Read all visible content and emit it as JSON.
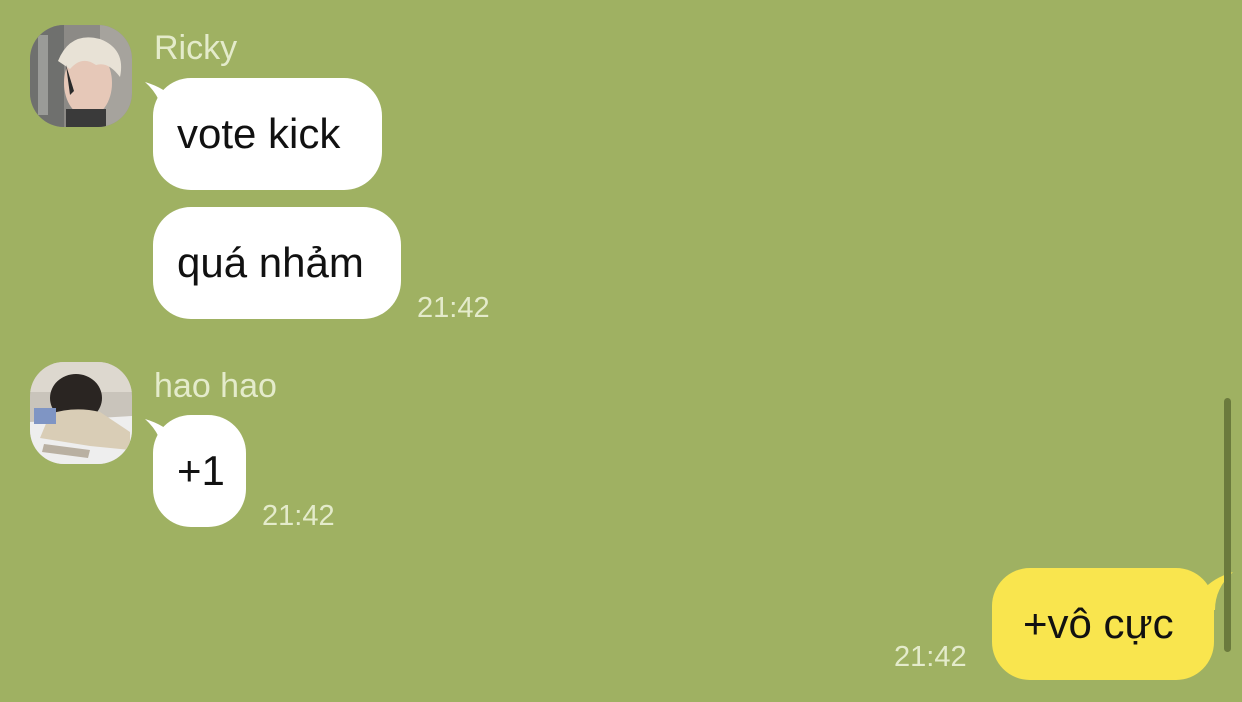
{
  "messages": {
    "ricky": {
      "sender": "Ricky",
      "bubble_1": "vote kick",
      "bubble_2": "quá nhảm",
      "time": "21:42"
    },
    "haohao": {
      "sender": "hao hao",
      "bubble_1": "+1",
      "time": "21:42"
    },
    "mine": {
      "bubble_1": "+vô cực",
      "time": "21:42"
    }
  },
  "colors": {
    "background": "#9fb162",
    "incoming_bubble": "#ffffff",
    "outgoing_bubble": "#f9e54e",
    "meta_text": "#e4ebcb"
  },
  "icons": {
    "ricky_avatar": "avatar-photo",
    "haohao_avatar": "avatar-photo"
  }
}
